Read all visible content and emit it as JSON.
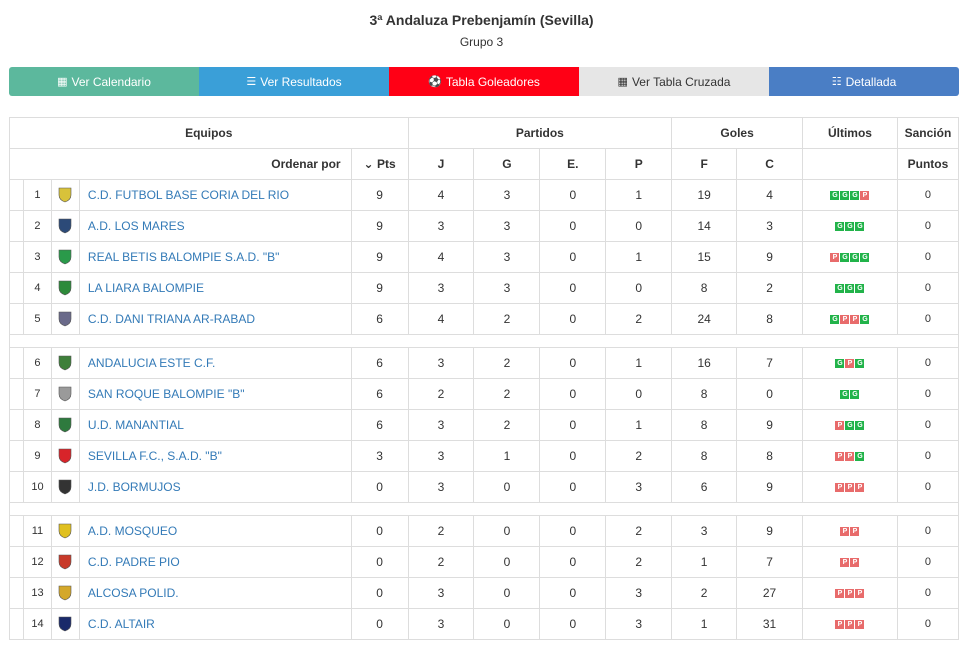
{
  "header": {
    "title": "3ª Andaluza Prebenjamín (Sevilla)",
    "subtitle": "Grupo 3"
  },
  "buttons": [
    {
      "label": "Ver Calendario",
      "icon": "calendar-icon"
    },
    {
      "label": "Ver Resultados",
      "icon": "list-icon"
    },
    {
      "label": "Tabla Goleadores",
      "icon": "soccer-ball-icon"
    },
    {
      "label": "Ver Tabla Cruzada",
      "icon": "grid-icon"
    },
    {
      "label": "Detallada",
      "icon": "detail-list-icon"
    }
  ],
  "table_headers": {
    "equipos": "Equipos",
    "partidos": "Partidos",
    "goles": "Goles",
    "ultimos": "Últimos",
    "sancion": "Sanción",
    "ordenar": "Ordenar por",
    "pts": "Pts",
    "j": "J",
    "g": "G",
    "e": "E.",
    "p": "P",
    "f": "F",
    "c": "C",
    "puntos": "Puntos"
  },
  "groups": [
    [
      {
        "pos": "1",
        "team": "C.D. FUTBOL BASE CORIA DEL RIO",
        "pts": "9",
        "j": "4",
        "g": "3",
        "e": "0",
        "p": "1",
        "f": "19",
        "c": "4",
        "form": [
          "G",
          "G",
          "G",
          "P"
        ],
        "sancion": "0",
        "logo": "#d8c23a"
      },
      {
        "pos": "2",
        "team": "A.D. LOS MARES",
        "pts": "9",
        "j": "3",
        "g": "3",
        "e": "0",
        "p": "0",
        "f": "14",
        "c": "3",
        "form": [
          "G",
          "G",
          "G"
        ],
        "sancion": "0",
        "logo": "#2c4a78"
      },
      {
        "pos": "3",
        "team": "REAL BETIS BALOMPIE S.A.D. \"B\"",
        "pts": "9",
        "j": "4",
        "g": "3",
        "e": "0",
        "p": "1",
        "f": "15",
        "c": "9",
        "form": [
          "P",
          "G",
          "G",
          "G"
        ],
        "sancion": "0",
        "logo": "#2a9a4a"
      },
      {
        "pos": "4",
        "team": "LA LIARA BALOMPIE",
        "pts": "9",
        "j": "3",
        "g": "3",
        "e": "0",
        "p": "0",
        "f": "8",
        "c": "2",
        "form": [
          "G",
          "G",
          "G"
        ],
        "sancion": "0",
        "logo": "#2d8a3a"
      },
      {
        "pos": "5",
        "team": "C.D. DANI TRIANA AR-RABAD",
        "pts": "6",
        "j": "4",
        "g": "2",
        "e": "0",
        "p": "2",
        "f": "24",
        "c": "8",
        "form": [
          "G",
          "P",
          "P",
          "G"
        ],
        "sancion": "0",
        "logo": "#6a6a8a"
      }
    ],
    [
      {
        "pos": "6",
        "team": "ANDALUCIA ESTE C.F.",
        "pts": "6",
        "j": "3",
        "g": "2",
        "e": "0",
        "p": "1",
        "f": "16",
        "c": "7",
        "form": [
          "G",
          "P",
          "G"
        ],
        "sancion": "0",
        "logo": "#3e7f3a"
      },
      {
        "pos": "7",
        "team": "SAN ROQUE BALOMPIE \"B\"",
        "pts": "6",
        "j": "2",
        "g": "2",
        "e": "0",
        "p": "0",
        "f": "8",
        "c": "0",
        "form": [
          "G",
          "G"
        ],
        "sancion": "0",
        "logo": "#9a9a9a"
      },
      {
        "pos": "8",
        "team": "U.D. MANANTIAL",
        "pts": "6",
        "j": "3",
        "g": "2",
        "e": "0",
        "p": "1",
        "f": "8",
        "c": "9",
        "form": [
          "P",
          "G",
          "G"
        ],
        "sancion": "0",
        "logo": "#2e7a3e"
      },
      {
        "pos": "9",
        "team": "SEVILLA F.C., S.A.D. \"B\"",
        "pts": "3",
        "j": "3",
        "g": "1",
        "e": "0",
        "p": "2",
        "f": "8",
        "c": "8",
        "form": [
          "P",
          "P",
          "G"
        ],
        "sancion": "0",
        "logo": "#d8242a"
      },
      {
        "pos": "10",
        "team": "J.D. BORMUJOS",
        "pts": "0",
        "j": "3",
        "g": "0",
        "e": "0",
        "p": "3",
        "f": "6",
        "c": "9",
        "form": [
          "P",
          "P",
          "P"
        ],
        "sancion": "0",
        "logo": "#333333"
      }
    ],
    [
      {
        "pos": "11",
        "team": "A.D. MOSQUEO",
        "pts": "0",
        "j": "2",
        "g": "0",
        "e": "0",
        "p": "2",
        "f": "3",
        "c": "9",
        "form": [
          "P",
          "P"
        ],
        "sancion": "0",
        "logo": "#e0c020"
      },
      {
        "pos": "12",
        "team": "C.D. PADRE PIO",
        "pts": "0",
        "j": "2",
        "g": "0",
        "e": "0",
        "p": "2",
        "f": "1",
        "c": "7",
        "form": [
          "P",
          "P"
        ],
        "sancion": "0",
        "logo": "#c83a2a"
      },
      {
        "pos": "13",
        "team": "ALCOSA POLID.",
        "pts": "0",
        "j": "3",
        "g": "0",
        "e": "0",
        "p": "3",
        "f": "2",
        "c": "27",
        "form": [
          "P",
          "P",
          "P"
        ],
        "sancion": "0",
        "logo": "#d4a82a"
      },
      {
        "pos": "14",
        "team": "C.D. ALTAIR",
        "pts": "0",
        "j": "3",
        "g": "0",
        "e": "0",
        "p": "3",
        "f": "1",
        "c": "31",
        "form": [
          "P",
          "P",
          "P"
        ],
        "sancion": "0",
        "logo": "#1a2a6a"
      }
    ]
  ]
}
